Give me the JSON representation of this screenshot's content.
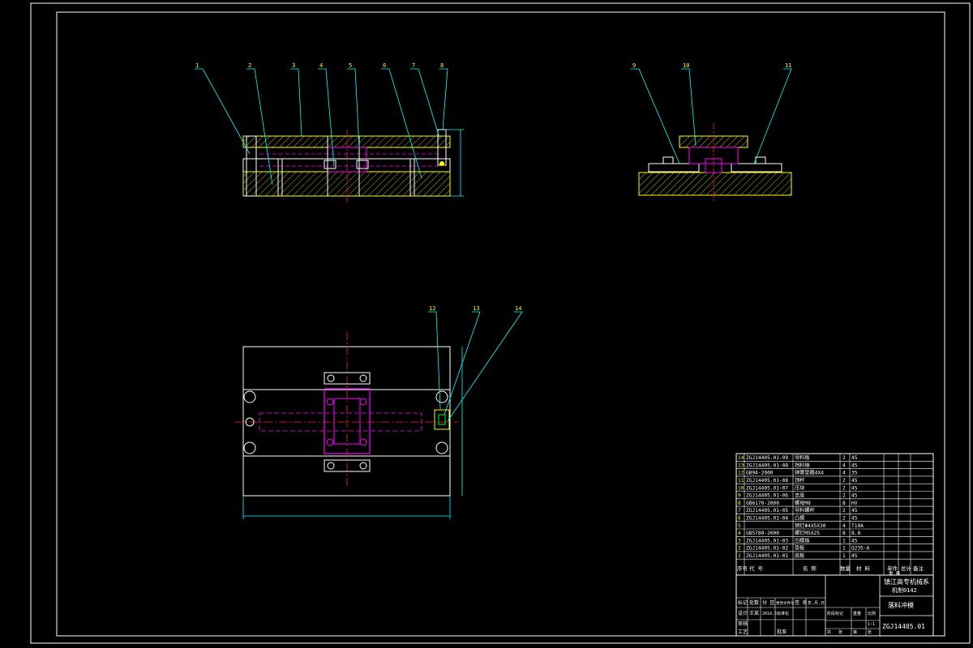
{
  "drawing": {
    "title_block": {
      "school_line1": "镇江高专机械系",
      "school_line2": "机制0142",
      "drawing_name": "落料冲模",
      "drawing_number": "ZGJ14405.01",
      "ratio_label": "1:1"
    },
    "leaders_top_view": [
      "1",
      "2",
      "3",
      "4",
      "5",
      "6",
      "7",
      "8"
    ],
    "leaders_side_view": [
      "9",
      "10",
      "11"
    ],
    "leaders_plan_view": [
      "12",
      "13",
      "14"
    ],
    "bom_header": {
      "seq": "序号",
      "code": "代 号",
      "name": "名 称",
      "qty": "数量",
      "material": "材 料",
      "weight": "单件 总计",
      "weight2": "重 量",
      "remark": "备注"
    },
    "bom": [
      {
        "no": "14",
        "code": "ZGJ14405.01-09",
        "name": "导料板",
        "qty": "2",
        "material": "45"
      },
      {
        "no": "13",
        "code": "ZGJ14405.01-08",
        "name": "挡料销",
        "qty": "4",
        "material": "45"
      },
      {
        "no": "12",
        "code": "GB94-2000",
        "name": "弹簧垫圈4X4",
        "qty": "4",
        "material": "35"
      },
      {
        "no": "11",
        "code": "ZGJ14405.01-08",
        "name": "顶杆",
        "qty": "2",
        "material": "45"
      },
      {
        "no": "10",
        "code": "ZGJ14405.01-07",
        "name": "压块",
        "qty": "2",
        "material": "45"
      },
      {
        "no": "9",
        "code": "ZGJ14405.01-06",
        "name": "支座",
        "qty": "2",
        "material": "45"
      },
      {
        "no": "8",
        "code": "GB6170-2000",
        "name": "螺母M8",
        "qty": "8",
        "material": "HV"
      },
      {
        "no": "7",
        "code": "ZGJ14405.01-05",
        "name": "导料螺杆",
        "qty": "2",
        "material": "45"
      },
      {
        "no": "6",
        "code": "ZGJ14405.01-04",
        "name": "凸模",
        "qty": "2",
        "material": "45"
      },
      {
        "no": "5",
        "code": "",
        "name": "销钉Φ4X5X30",
        "qty": "4",
        "material": "T10A"
      },
      {
        "no": "4",
        "code": "GB5780-2000",
        "name": "螺钉M5X25",
        "qty": "8",
        "material": "8.8"
      },
      {
        "no": "3",
        "code": "ZGJ14405.01-03",
        "name": "凹模板",
        "qty": "1",
        "material": "45"
      },
      {
        "no": "2",
        "code": "ZGJ14405.01-02",
        "name": "垫板",
        "qty": "1",
        "material": "Q235-A"
      },
      {
        "no": "1",
        "code": "ZGJ14405.01-01",
        "name": "底板",
        "qty": "1",
        "material": "45"
      }
    ],
    "title_rows": {
      "row1": [
        "标记",
        "处数",
        "分 区",
        "更改文件号",
        "签 名",
        "年.月.日"
      ],
      "row2": [
        "设计",
        "王某",
        "2014.5",
        "标准化",
        "",
        "阶段标记",
        "重量",
        "比例"
      ],
      "row3": [
        "审核"
      ],
      "row4": [
        "工艺",
        "",
        "",
        "批准",
        "",
        "共",
        "张",
        "第",
        "张"
      ]
    },
    "colors": {
      "line_white": "#ffffff",
      "leader_cyan": "#00ffff",
      "hidden_magenta": "#ff00ff",
      "center_red": "#ff2020",
      "hatch_yellow": "#ffff00",
      "accent_green": "#00ff00"
    }
  }
}
